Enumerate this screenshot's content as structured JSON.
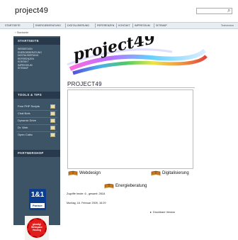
{
  "header": {
    "site_title": "project49"
  },
  "topnav": {
    "items": [
      "Startseite",
      "Energieberatung",
      "Digitalisierung",
      "Referenzen",
      "Kontakt",
      "Impressum",
      "Sitemap"
    ],
    "right_label": "Textversion"
  },
  "breadcrumb": {
    "label": "Startseite"
  },
  "sidebar": {
    "section1_title": "STARTSEITE",
    "links": [
      "Webdesign",
      "Energieberatung",
      "Digitalisierung",
      "Referenzen",
      "Kontakt",
      "Impressum",
      "Sitemap"
    ],
    "section2_title": "TOOLS & TIPS",
    "tools": [
      "Free PHP Scripts",
      "Chat Bots",
      "Dynamic Drive",
      "Dr. Web",
      "Open Cubic"
    ],
    "section3_title": "PARTNERSHOP",
    "partner_logo_num": "1&1",
    "partner_logo_label": "Partner",
    "seal_text": "günstig! Webspace Hosting"
  },
  "main": {
    "logo_text": "project49",
    "page_title": "PROJECT49",
    "links": {
      "webdesign": "Webdesign",
      "digitalisierung": "Digitalisierung",
      "energieberatung": "Energieberatung"
    },
    "counter_text": "Zugriffe heute: 6 - gesamt: 2818.",
    "datetime_text": "Montag, 16. Februar 2009, 16:29",
    "print_label": "Druckbare Version"
  },
  "colors": {
    "sidebar_bg": "#3d5466",
    "sidebar_header": "#27394a",
    "nav_bg": "#e8edf2"
  }
}
